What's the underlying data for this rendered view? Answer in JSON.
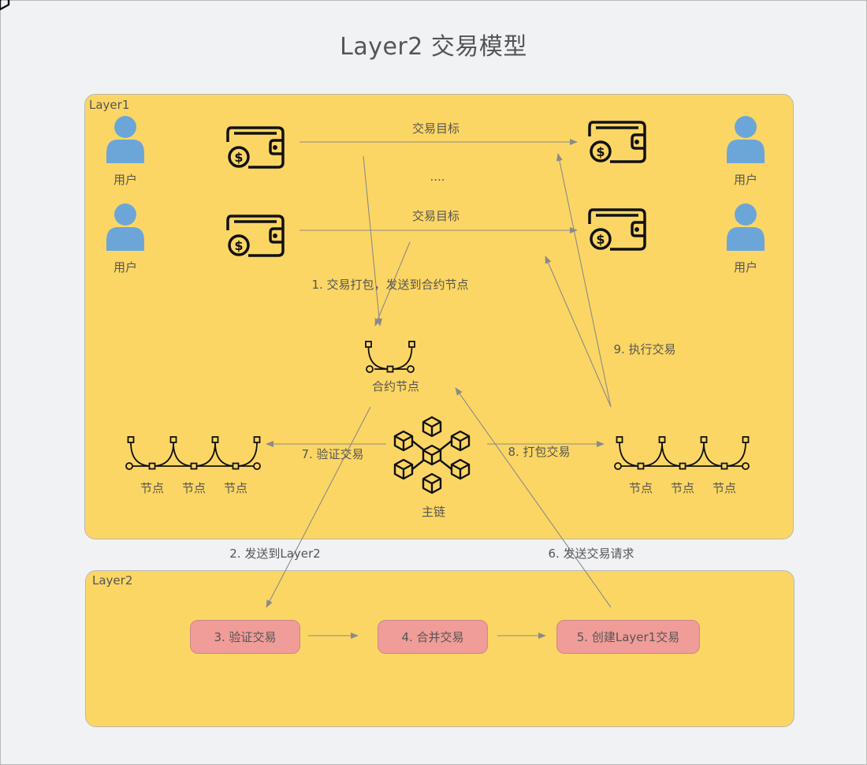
{
  "title": "Layer2 交易模型",
  "layer1": {
    "label": "Layer1"
  },
  "layer2": {
    "label": "Layer2"
  },
  "users": {
    "label": "用户"
  },
  "transfers": {
    "target_label": "交易目标",
    "ellipsis": "...."
  },
  "contract_node": {
    "label": "合约节点"
  },
  "main_chain": {
    "label": "主链"
  },
  "node_cluster": {
    "node_label": "节点"
  },
  "steps": {
    "s1": "1. 交易打包，发送到合约节点",
    "s2": "2. 发送到Layer2",
    "s3": "3. 验证交易",
    "s4": "4. 合并交易",
    "s5": "5. 创建Layer1交易",
    "s6": "6. 发送交易请求",
    "s7": "7. 验证交易",
    "s8": "8. 打包交易",
    "s9": "9. 执行交易"
  },
  "colors": {
    "background": "#f1f2f4",
    "layer_fill": "#fcd664",
    "step_box": "#f09c98",
    "user_icon": "#6ca6d9",
    "arrow": "#8a8a8a",
    "icon_stroke": "#111111"
  },
  "icons": {
    "user": "user-icon",
    "wallet": "wallet-icon",
    "node": "bezier-node-icon",
    "chain": "blockchain-cubes-icon"
  }
}
